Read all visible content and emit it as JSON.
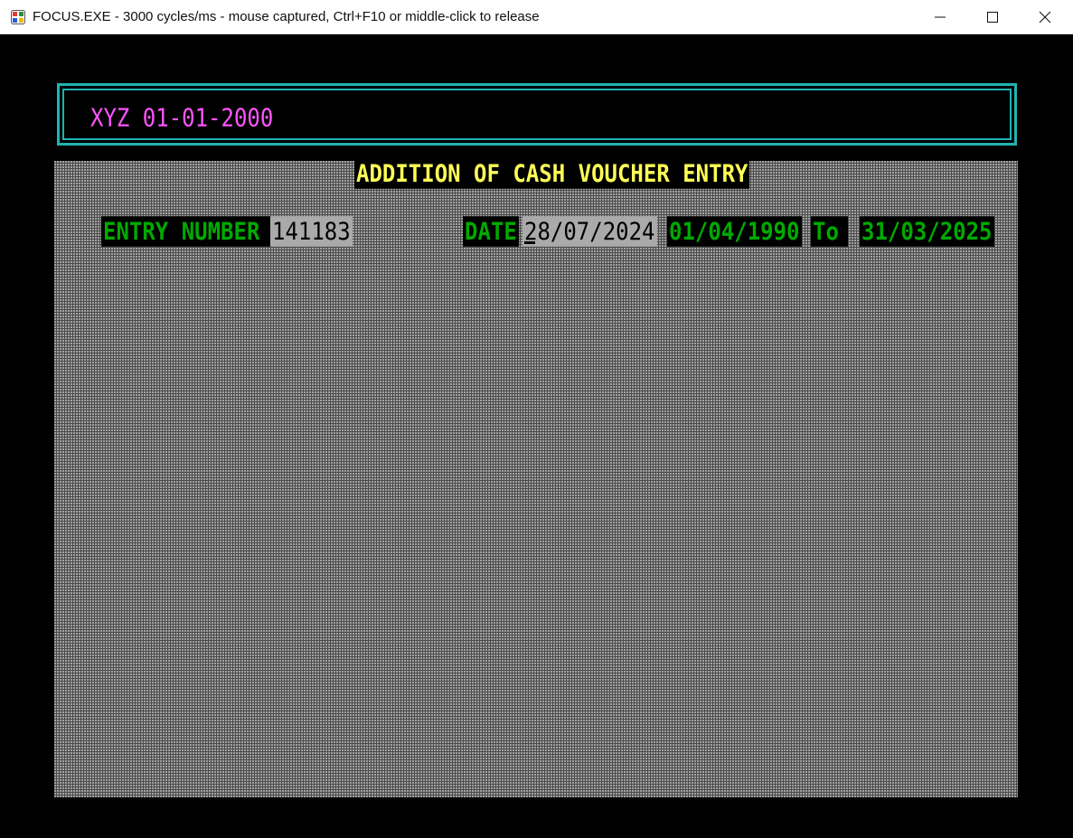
{
  "window": {
    "title": "FOCUS.EXE - 3000 cycles/ms - mouse captured, Ctrl+F10 or middle-click to release",
    "icon": "dosbox-app-icon",
    "controls": [
      "minimize-icon",
      "maximize-icon",
      "close-icon"
    ]
  },
  "header": {
    "company": "XYZ 01-01-2000"
  },
  "form": {
    "title": "ADDITION OF CASH VOUCHER ENTRY",
    "entry_number_label": "ENTRY NUMBER",
    "entry_number_value": "141183",
    "date_label": "DATE",
    "date_value": "28/07/2024",
    "period_from": "01/04/1990",
    "to_label": "To",
    "period_to": "31/03/2025"
  },
  "colors": {
    "frame": "#21b3b3",
    "company": "#ff55ff",
    "title": "#ffff55",
    "label": "#00aa00",
    "input_bg": "#aaaaaa"
  }
}
